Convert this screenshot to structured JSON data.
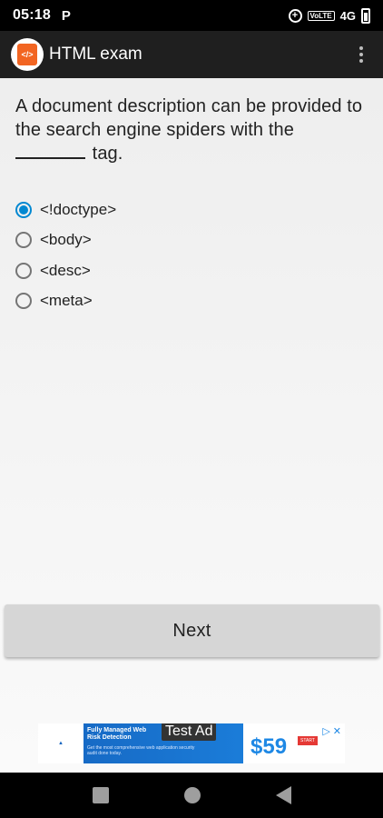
{
  "status_bar": {
    "time": "05:18",
    "carrier_icon": "P",
    "network": "4G",
    "volte": "VoLTE"
  },
  "app_bar": {
    "title": "HTML exam",
    "logo_glyph": "</>"
  },
  "question": {
    "text_before": "A document description can be provided to the search engine spiders with the",
    "text_after": "tag."
  },
  "options": [
    {
      "label": "<!doctype>",
      "selected": true
    },
    {
      "label": "<body>",
      "selected": false
    },
    {
      "label": "<desc>",
      "selected": false
    },
    {
      "label": "<meta>",
      "selected": false
    }
  ],
  "next_button": {
    "label": "Next"
  },
  "ad": {
    "label": "Test Ad",
    "headline_1": "Fully Managed Web",
    "headline_2": "Risk Detection",
    "body": "Get the most comprehensive web application security audit done today.",
    "price": "$59"
  },
  "colors": {
    "accent": "#0288d1",
    "app_bar": "#1f1f1f",
    "logo": "#f26522"
  }
}
